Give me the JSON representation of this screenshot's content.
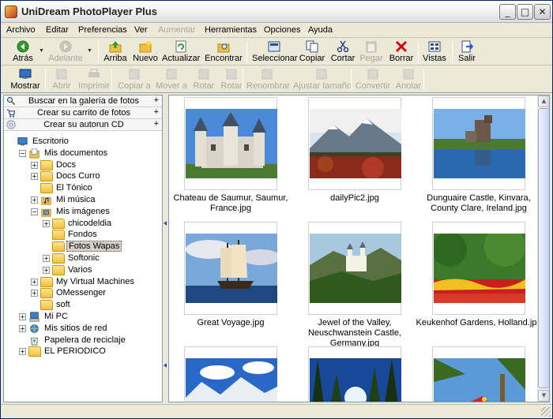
{
  "window": {
    "title": "UniDream PhotoPlayer Plus"
  },
  "menu": [
    {
      "label": "Archivo",
      "enabled": true
    },
    {
      "label": "Editar",
      "enabled": true
    },
    {
      "label": "Preferencias",
      "enabled": true
    },
    {
      "label": "Ver",
      "enabled": true
    },
    {
      "label": "Aumentar",
      "enabled": false
    },
    {
      "label": "Herramientas",
      "enabled": true
    },
    {
      "label": "Opciones",
      "enabled": true
    },
    {
      "label": "Ayuda",
      "enabled": true
    }
  ],
  "toolbar1": [
    {
      "label": "Atrás",
      "icon": "back-arrow-icon",
      "enabled": true
    },
    {
      "label": "Adelante",
      "icon": "forward-arrow-icon",
      "enabled": false
    },
    {
      "label": "Arriba",
      "icon": "up-folder-icon",
      "enabled": true
    },
    {
      "label": "Nuevo",
      "icon": "new-folder-icon",
      "enabled": true
    },
    {
      "label": "Actualizar",
      "icon": "refresh-icon",
      "enabled": true
    },
    {
      "label": "Encontrar",
      "icon": "find-folder-icon",
      "enabled": true
    },
    {
      "label": "Seleccionar",
      "icon": "select-icon",
      "enabled": true
    },
    {
      "label": "Copiar",
      "icon": "copy-icon",
      "enabled": true
    },
    {
      "label": "Cortar",
      "icon": "scissors-icon",
      "enabled": true
    },
    {
      "label": "Pegar",
      "icon": "paste-icon",
      "enabled": false
    },
    {
      "label": "Borrar",
      "icon": "delete-x-icon",
      "enabled": true
    },
    {
      "label": "Vistas",
      "icon": "views-icon",
      "enabled": true
    },
    {
      "label": "Salir",
      "icon": "exit-icon",
      "enabled": true
    }
  ],
  "toolbar2": [
    {
      "label": "Mostrar",
      "icon": "monitor-icon",
      "enabled": true
    },
    {
      "label": "Abrir",
      "icon": "open-icon",
      "enabled": false
    },
    {
      "label": "Imprimir",
      "icon": "printer-icon",
      "enabled": false
    },
    {
      "label": "Copiar a",
      "icon": "copy-to-icon",
      "enabled": false
    },
    {
      "label": "Mover a",
      "icon": "move-to-icon",
      "enabled": false
    },
    {
      "label": "Rotar",
      "icon": "rotate-left-icon",
      "enabled": false
    },
    {
      "label": "Rotar",
      "icon": "rotate-right-icon",
      "enabled": false
    },
    {
      "label": "Renombrar",
      "icon": "rename-icon",
      "enabled": false
    },
    {
      "label": "Ajustar tamaño",
      "icon": "resize-icon",
      "enabled": false
    },
    {
      "label": "Convertir",
      "icon": "convert-icon",
      "enabled": false
    },
    {
      "label": "Anotar",
      "icon": "annotate-icon",
      "enabled": false
    }
  ],
  "actions": [
    {
      "label": "Buscar en la galería de fotos",
      "icon": "search-icon"
    },
    {
      "label": "Crear su carrito de fotos",
      "icon": "cart-icon"
    },
    {
      "label": "Crear su autorun CD",
      "icon": "cd-icon"
    }
  ],
  "tree": [
    {
      "label": "Escritorio",
      "level": 0,
      "expander": "",
      "icon": "desktop-icon"
    },
    {
      "label": "Mis documentos",
      "level": 1,
      "expander": "−",
      "icon": "my-documents-icon"
    },
    {
      "label": "Docs",
      "level": 2,
      "expander": "+",
      "icon": "folder-icon"
    },
    {
      "label": "Docs Curro",
      "level": 2,
      "expander": "+",
      "icon": "folder-icon"
    },
    {
      "label": "El Tónico",
      "level": 2,
      "expander": "",
      "icon": "folder-icon"
    },
    {
      "label": "Mi música",
      "level": 2,
      "expander": "+",
      "icon": "music-folder-icon"
    },
    {
      "label": "Mis imágenes",
      "level": 2,
      "expander": "−",
      "icon": "pictures-folder-icon"
    },
    {
      "label": "chicodeldia",
      "level": 3,
      "expander": "+",
      "icon": "folder-icon"
    },
    {
      "label": "Fondos",
      "level": 3,
      "expander": "",
      "icon": "folder-icon"
    },
    {
      "label": "Fotos Wapas",
      "level": 3,
      "expander": "",
      "icon": "folder-icon",
      "selected": true
    },
    {
      "label": "Softonic",
      "level": 3,
      "expander": "+",
      "icon": "folder-icon"
    },
    {
      "label": "Varios",
      "level": 3,
      "expander": "+",
      "icon": "folder-icon"
    },
    {
      "label": "My Virtual Machines",
      "level": 2,
      "expander": "+",
      "icon": "folder-icon"
    },
    {
      "label": "OMessenger",
      "level": 2,
      "expander": "+",
      "icon": "folder-icon"
    },
    {
      "label": "soft",
      "level": 2,
      "expander": "",
      "icon": "folder-icon"
    },
    {
      "label": "Mi PC",
      "level": 1,
      "expander": "+",
      "icon": "my-computer-icon"
    },
    {
      "label": "Mis sitios de red",
      "level": 1,
      "expander": "+",
      "icon": "network-icon"
    },
    {
      "label": "Papelera de reciclaje",
      "level": 1,
      "expander": "",
      "icon": "recycle-bin-icon"
    },
    {
      "label": "EL PERIODICO",
      "level": 1,
      "expander": "+",
      "icon": "folder-icon"
    }
  ],
  "thumbnails": [
    {
      "caption": "Chateau de Saumur, Saumur, France.jpg",
      "scene": "castle-sky"
    },
    {
      "caption": "dailyPic2.jpg",
      "scene": "mountain-lake"
    },
    {
      "caption": "Dunguaire Castle, Kinvara, County Clare, Ireland.jpg",
      "scene": "castle-water"
    },
    {
      "caption": "Great Voyage.jpg",
      "scene": "sailing-ship"
    },
    {
      "caption": "Jewel of the Valley, Neuschwanstein Castle, Germany.jpg",
      "scene": "castle-valley"
    },
    {
      "caption": "Keukenhof Gardens, Holland.jpg",
      "scene": "garden"
    },
    {
      "caption": "",
      "scene": "mountain-clouds"
    },
    {
      "caption": "",
      "scene": "sun-trees"
    },
    {
      "caption": "",
      "scene": "parrot-palm"
    }
  ]
}
